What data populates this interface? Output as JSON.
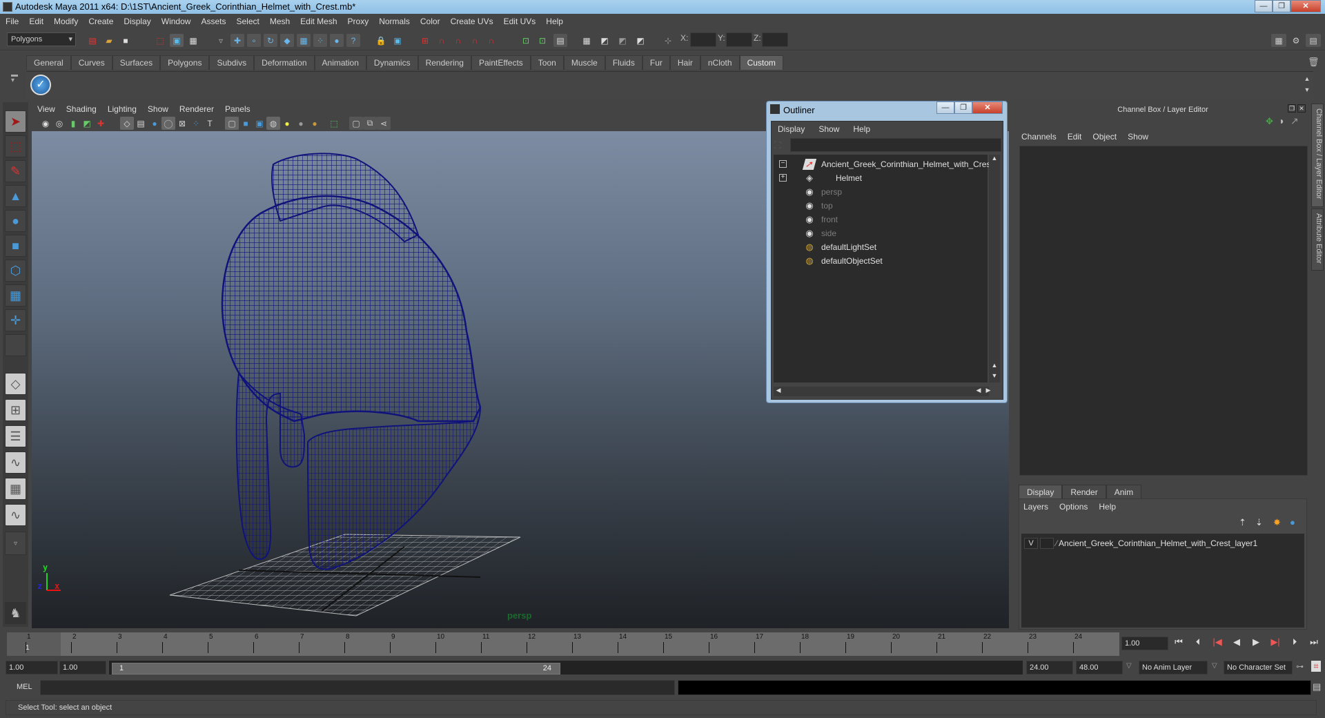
{
  "window": {
    "title": "Autodesk Maya 2011 x64: D:\\1ST\\Ancient_Greek_Corinthian_Helmet_with_Crest.mb*",
    "minimize": "—",
    "maximize": "❐",
    "close": "✕"
  },
  "menubar": [
    "File",
    "Edit",
    "Modify",
    "Create",
    "Display",
    "Window",
    "Assets",
    "Select",
    "Mesh",
    "Edit Mesh",
    "Proxy",
    "Normals",
    "Color",
    "Create UVs",
    "Edit UVs",
    "Help"
  ],
  "statusline": {
    "menuset": "Polygons",
    "x_label": "X:",
    "y_label": "Y:",
    "z_label": "Z:",
    "x_value": "",
    "y_value": "",
    "z_value": ""
  },
  "shelf": {
    "tabs": [
      "General",
      "Curves",
      "Surfaces",
      "Polygons",
      "Subdivs",
      "Deformation",
      "Animation",
      "Dynamics",
      "Rendering",
      "PaintEffects",
      "Toon",
      "Muscle",
      "Fluids",
      "Fur",
      "Hair",
      "nCloth",
      "Custom"
    ],
    "active_tab": "Custom"
  },
  "viewport": {
    "menu": [
      "View",
      "Shading",
      "Lighting",
      "Show",
      "Renderer",
      "Panels"
    ],
    "camera_label": "persp",
    "axis": {
      "y": "y",
      "z": "z",
      "x": "x"
    },
    "wire_color": "#10137a"
  },
  "outliner": {
    "title": "Outliner",
    "menu": [
      "Display",
      "Show",
      "Help"
    ],
    "filter": "",
    "items": [
      {
        "label": "Ancient_Greek_Corinthian_Helmet_with_Crest",
        "icon": "transform-icon",
        "dim": false,
        "expand": "−"
      },
      {
        "label": "Helmet",
        "icon": "mesh-icon",
        "dim": false,
        "expand": "+"
      },
      {
        "label": "persp",
        "icon": "camera-icon",
        "dim": true,
        "expand": ""
      },
      {
        "label": "top",
        "icon": "camera-icon",
        "dim": true,
        "expand": ""
      },
      {
        "label": "front",
        "icon": "camera-icon",
        "dim": true,
        "expand": ""
      },
      {
        "label": "side",
        "icon": "camera-icon",
        "dim": true,
        "expand": ""
      },
      {
        "label": "defaultLightSet",
        "icon": "set-icon",
        "dim": false,
        "expand": ""
      },
      {
        "label": "defaultObjectSet",
        "icon": "set-icon",
        "dim": false,
        "expand": ""
      }
    ]
  },
  "channelbox": {
    "title": "Channel Box / Layer Editor",
    "menu": [
      "Channels",
      "Edit",
      "Object",
      "Show"
    ],
    "layer_tabs": [
      "Display",
      "Render",
      "Anim"
    ],
    "active_layer_tab": "Display",
    "layer_menu": [
      "Layers",
      "Options",
      "Help"
    ],
    "layers": [
      {
        "visible": "V",
        "type": "",
        "name": "Ancient_Greek_Corinthian_Helmet_with_Crest_layer1"
      }
    ]
  },
  "side_tabs": [
    "Channel Box / Layer Editor",
    "Attribute Editor"
  ],
  "timeline": {
    "start": 1,
    "end": 24,
    "current_frame_marker": "1",
    "current_time": "1.00"
  },
  "range": {
    "start_time": "1.00",
    "playback_start": "1.00",
    "slider_start": "1",
    "slider_end": "24",
    "playback_end": "24.00",
    "end_time": "48.00",
    "anim_layer": "No Anim Layer",
    "character_set": "No Character Set"
  },
  "command": {
    "label": "MEL",
    "input": "",
    "result": ""
  },
  "help_line": "Select Tool: select an object"
}
